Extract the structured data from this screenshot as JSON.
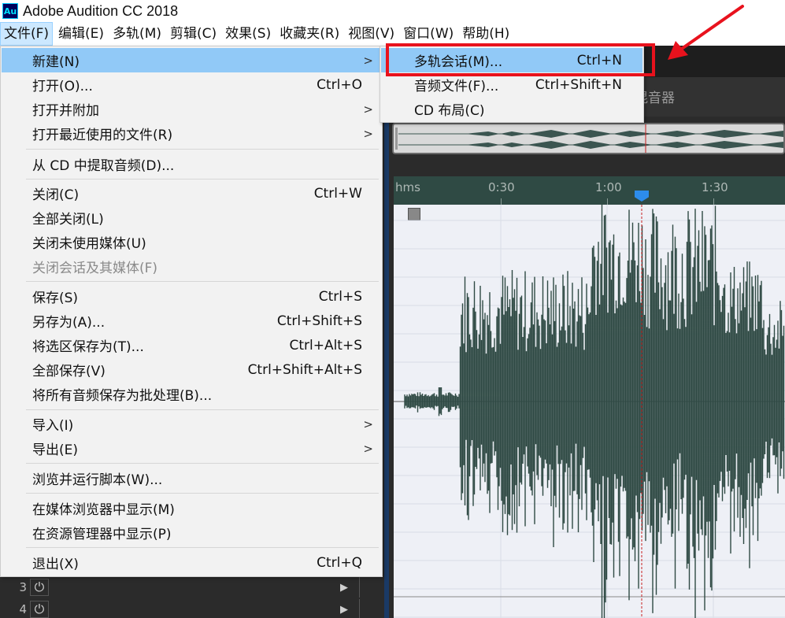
{
  "app": {
    "logo_text": "Au",
    "title": "Adobe Audition CC 2018"
  },
  "menubar": [
    "文件(F)",
    "编辑(E)",
    "多轨(M)",
    "剪辑(C)",
    "效果(S)",
    "收藏夹(R)",
    "视图(V)",
    "窗口(W)",
    "帮助(H)"
  ],
  "file_menu": {
    "new": {
      "label": "新建(N)"
    },
    "open": {
      "label": "打开(O)...",
      "shortcut": "Ctrl+O"
    },
    "open_append": {
      "label": "打开并附加"
    },
    "open_recent": {
      "label": "打开最近使用的文件(R)"
    },
    "extract_cd": {
      "label": "从 CD 中提取音频(D)..."
    },
    "close": {
      "label": "关闭(C)",
      "shortcut": "Ctrl+W"
    },
    "close_all": {
      "label": "全部关闭(L)"
    },
    "close_unused": {
      "label": "关闭未使用媒体(U)"
    },
    "close_session": {
      "label": "关闭会话及其媒体(F)"
    },
    "save": {
      "label": "保存(S)",
      "shortcut": "Ctrl+S"
    },
    "save_as": {
      "label": "另存为(A)...",
      "shortcut": "Ctrl+Shift+S"
    },
    "save_selection": {
      "label": "将选区保存为(T)...",
      "shortcut": "Ctrl+Alt+S"
    },
    "save_all": {
      "label": "全部保存(V)",
      "shortcut": "Ctrl+Shift+Alt+S"
    },
    "save_batch": {
      "label": "将所有音频保存为批处理(B)..."
    },
    "import": {
      "label": "导入(I)"
    },
    "export": {
      "label": "导出(E)"
    },
    "run_script": {
      "label": "浏览并运行脚本(W)..."
    },
    "reveal_media": {
      "label": "在媒体浏览器中显示(M)"
    },
    "reveal_explorer": {
      "label": "在资源管理器中显示(P)"
    },
    "exit": {
      "label": "退出(X)",
      "shortcut": "Ctrl+Q"
    }
  },
  "submenu_arrow": ">",
  "new_submenu": {
    "multitrack": {
      "label": "多轨会话(M)...",
      "shortcut": "Ctrl+N"
    },
    "audio_file": {
      "label": "音频文件(F)...",
      "shortcut": "Ctrl+Shift+N"
    },
    "cd_layout": {
      "label": "CD 布局(C)"
    }
  },
  "panel": {
    "mixer_tab": "混音器"
  },
  "ruler": {
    "unit": "hms",
    "ticks": [
      "0:30",
      "1:00",
      "1:30"
    ]
  },
  "tracks": [
    {
      "num": "3"
    },
    {
      "num": "4"
    }
  ],
  "icons": {
    "power": "⏻",
    "play_arrow": "▶"
  },
  "colors": {
    "accent_red": "#e8121d",
    "menu_highlight": "#91c9f7",
    "waveform": "#2f4a44"
  }
}
